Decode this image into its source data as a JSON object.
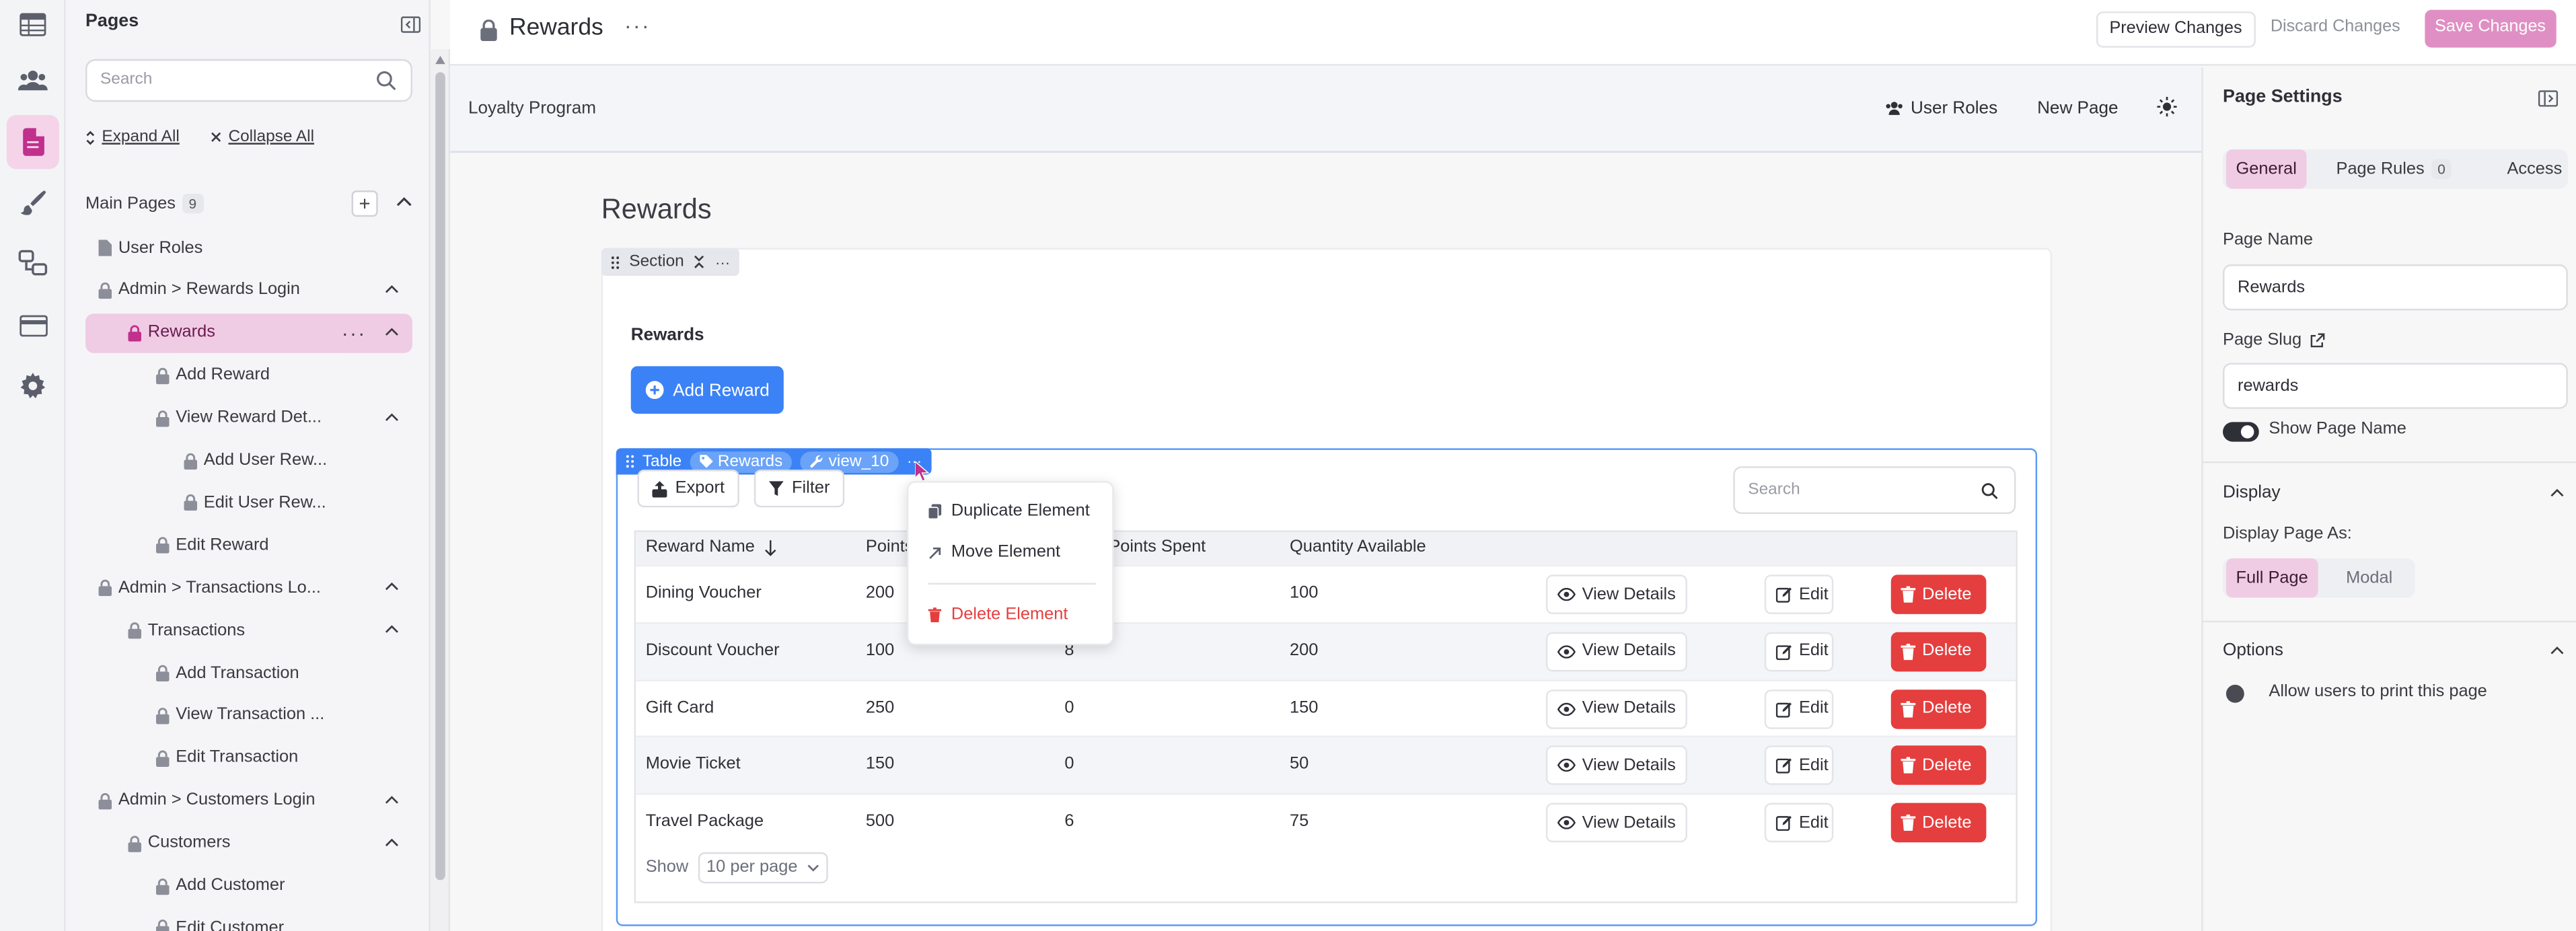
{
  "app": {
    "page_title": "Rewards",
    "actions": {
      "preview": "Preview Changes",
      "discard": "Discard Changes",
      "save": "Save Changes"
    },
    "accent": "#e08fc4"
  },
  "rail": [
    "table-icon",
    "users-icon",
    "pages-icon",
    "brush-icon",
    "flow-icon",
    "card-icon",
    "gear-icon"
  ],
  "pages_panel": {
    "title": "Pages",
    "search_placeholder": "Search",
    "expand_all": "Expand All",
    "collapse_all": "Collapse All",
    "group_label": "Main Pages",
    "group_count": "9",
    "items": [
      {
        "label": "User Roles",
        "icon": "page-icon",
        "level": 0
      },
      {
        "label": "Admin > Rewards Login",
        "icon": "lock-icon",
        "level": 0
      },
      {
        "label": "Rewards",
        "icon": "lock-icon",
        "level": 1
      },
      {
        "label": "Add Reward",
        "icon": "lock-icon",
        "level": 2
      },
      {
        "label": "View Reward Det...",
        "icon": "lock-icon",
        "level": 2
      },
      {
        "label": "Add User Rew...",
        "icon": "lock-icon",
        "level": 3
      },
      {
        "label": "Edit User Rew...",
        "icon": "lock-icon",
        "level": 3
      },
      {
        "label": "Edit Reward",
        "icon": "lock-icon",
        "level": 2
      },
      {
        "label": "Admin > Transactions Lo...",
        "icon": "lock-icon",
        "level": 0
      },
      {
        "label": "Transactions",
        "icon": "lock-icon",
        "level": 1
      },
      {
        "label": "Add Transaction",
        "icon": "lock-icon",
        "level": 2
      },
      {
        "label": "View Transaction ...",
        "icon": "lock-icon",
        "level": 2
      },
      {
        "label": "Edit Transaction",
        "icon": "lock-icon",
        "level": 2
      },
      {
        "label": "Admin > Customers Login",
        "icon": "lock-icon",
        "level": 0
      },
      {
        "label": "Customers",
        "icon": "lock-icon",
        "level": 1
      },
      {
        "label": "Add Customer",
        "icon": "lock-icon",
        "level": 2
      },
      {
        "label": "Edit Customer",
        "icon": "lock-icon",
        "level": 2
      }
    ]
  },
  "canvas": {
    "brand": "Loyalty Program",
    "nav_user_roles": "User Roles",
    "nav_new_page": "New Page",
    "heading": "Rewards",
    "section_tag": "Section",
    "view_title": "Rewards",
    "add_button": "Add Reward",
    "table_tag": {
      "type": "Table",
      "source": "Rewards",
      "key": "view_10"
    },
    "export": "Export",
    "filter": "Filter",
    "search_placeholder": "Search",
    "columns": [
      "Reward Name",
      "Points",
      "Points Spent",
      "Quantity Available"
    ],
    "rows": [
      {
        "name": "Dining Voucher",
        "points": "200",
        "spent": "",
        "qty": "100"
      },
      {
        "name": "Discount Voucher",
        "points": "100",
        "spent": "8",
        "qty": "200"
      },
      {
        "name": "Gift Card",
        "points": "250",
        "spent": "0",
        "qty": "150"
      },
      {
        "name": "Movie Ticket",
        "points": "150",
        "spent": "0",
        "qty": "50"
      },
      {
        "name": "Travel Package",
        "points": "500",
        "spent": "6",
        "qty": "75"
      }
    ],
    "row_actions": {
      "view": "View Details",
      "edit": "Edit",
      "delete": "Delete"
    },
    "pager": {
      "show": "Show",
      "per_page": "10 per page"
    },
    "context_menu": {
      "duplicate": "Duplicate Element",
      "move": "Move Element",
      "delete": "Delete Element"
    }
  },
  "settings": {
    "title": "Page Settings",
    "tabs": {
      "general": "General",
      "rules": "Page Rules",
      "rules_count": "0",
      "access": "Access"
    },
    "page_name_label": "Page Name",
    "page_name_value": "Rewards",
    "slug_label": "Page Slug",
    "slug_value": "rewards",
    "show_name": "Show Page Name",
    "display_heading": "Display",
    "display_as": "Display Page As:",
    "full_page": "Full Page",
    "modal": "Modal",
    "options_heading": "Options",
    "print_option": "Allow users to print this page"
  }
}
